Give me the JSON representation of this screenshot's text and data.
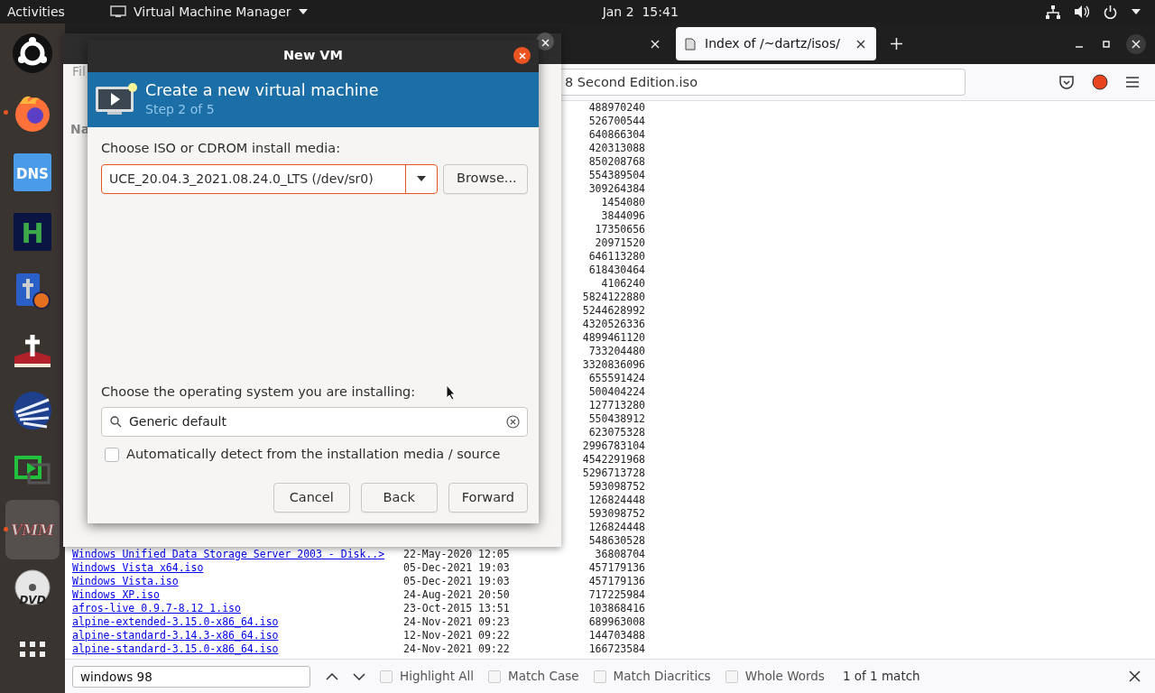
{
  "top_bar": {
    "activities": "Activities",
    "app_menu": "Virtual Machine Manager",
    "clock": "Jan 2  15:41"
  },
  "dock": [
    {
      "kind": "ubuntu",
      "running": false,
      "active": false
    },
    {
      "kind": "firefox",
      "running": true,
      "active": false
    },
    {
      "kind": "tile",
      "label": "DNS",
      "running": false,
      "active": false
    },
    {
      "kind": "letter",
      "label": "H",
      "running": false,
      "active": false
    },
    {
      "kind": "bible",
      "running": false,
      "active": false
    },
    {
      "kind": "cross-book",
      "running": false,
      "active": false
    },
    {
      "kind": "globe",
      "running": false,
      "active": false
    },
    {
      "kind": "screen-share",
      "running": false,
      "active": false
    },
    {
      "kind": "vmm",
      "label": "VMM",
      "running": true,
      "active": true
    },
    {
      "kind": "disc",
      "label": "DVD",
      "running": false,
      "active": false
    },
    {
      "kind": "apps-grid",
      "running": false,
      "active": false
    }
  ],
  "browser": {
    "tabs": [
      {
        "selected": false
      },
      {
        "title": "Index of /~dartz/isos/",
        "selected": true
      }
    ],
    "url": "8 Second Edition.iso",
    "listing": [
      {
        "size": "488970240"
      },
      {
        "size": "526700544"
      },
      {
        "size": "640866304"
      },
      {
        "size": "420313088"
      },
      {
        "size": "850208768"
      },
      {
        "size": "554389504"
      },
      {
        "size": "309264384"
      },
      {
        "size": "1454080"
      },
      {
        "size": "3844096"
      },
      {
        "size": "17350656"
      },
      {
        "size": "20971520"
      },
      {
        "size": "646113280"
      },
      {
        "size": "618430464"
      },
      {
        "size": "4106240"
      },
      {
        "size": "5824122880"
      },
      {
        "size": "5244628992"
      },
      {
        "size": "4320526336"
      },
      {
        "size": "4899461120"
      },
      {
        "size": "733204480"
      },
      {
        "size": "3320836096"
      },
      {
        "size": "655591424"
      },
      {
        "size": "500404224"
      },
      {
        "size": "127713280"
      },
      {
        "size": "550438912"
      },
      {
        "size": "623075328"
      },
      {
        "size": "2996783104"
      },
      {
        "size": "4542291968"
      },
      {
        "size": "5296713728"
      },
      {
        "size": "593098752"
      },
      {
        "size": "126824448"
      },
      {
        "size": "593098752"
      },
      {
        "size": "126824448"
      },
      {
        "size": "548630528"
      },
      {
        "name": "Windows Unified Data Storage Server 2003 - Disk..>",
        "date": "22-May-2020 12:05",
        "size": "36808704"
      },
      {
        "name": "Windows Vista x64.iso",
        "date": "05-Dec-2021 19:03",
        "size": "457179136"
      },
      {
        "name": "Windows Vista.iso",
        "date": "05-Dec-2021 19:03",
        "size": "457179136"
      },
      {
        "name": "Windows XP.iso",
        "date": "24-Aug-2021 20:50",
        "size": "717225984"
      },
      {
        "name": "afros-live 0.9.7-8.12 1.iso",
        "date": "23-Oct-2015 13:51",
        "size": "103868416"
      },
      {
        "name": "alpine-extended-3.15.0-x86_64.iso",
        "date": "24-Nov-2021 09:23",
        "size": "689963008"
      },
      {
        "name": "alpine-standard-3.14.3-x86_64.iso",
        "date": "12-Nov-2021 09:22",
        "size": "144703488"
      },
      {
        "name": "alpine-standard-3.15.0-x86_64.iso",
        "date": "24-Nov-2021 09:22",
        "size": "166723584"
      }
    ],
    "find_bar": {
      "query": "windows 98",
      "options": [
        {
          "label": "Highlight All",
          "checked": false
        },
        {
          "label": "Match Case",
          "checked": false
        },
        {
          "label": "Match Diacritics",
          "checked": false
        },
        {
          "label": "Whole Words",
          "checked": false
        }
      ],
      "result": "1 of 1 match"
    }
  },
  "vmm_window": {
    "menu": "Fil",
    "column": "Na"
  },
  "dialog": {
    "title": "New VM",
    "heading": "Create a new virtual machine",
    "step": "Step 2 of 5",
    "media_label": "Choose ISO or CDROM install media:",
    "media_value": "UCE_20.04.3_2021.08.24.0_LTS (/dev/sr0)",
    "browse": "Browse...",
    "os_label": "Choose the operating system you are installing:",
    "os_value": "Generic default",
    "auto_detect": {
      "label": "Automatically detect from the installation media / source",
      "checked": false
    },
    "buttons": [
      "Cancel",
      "Back",
      "Forward"
    ]
  }
}
